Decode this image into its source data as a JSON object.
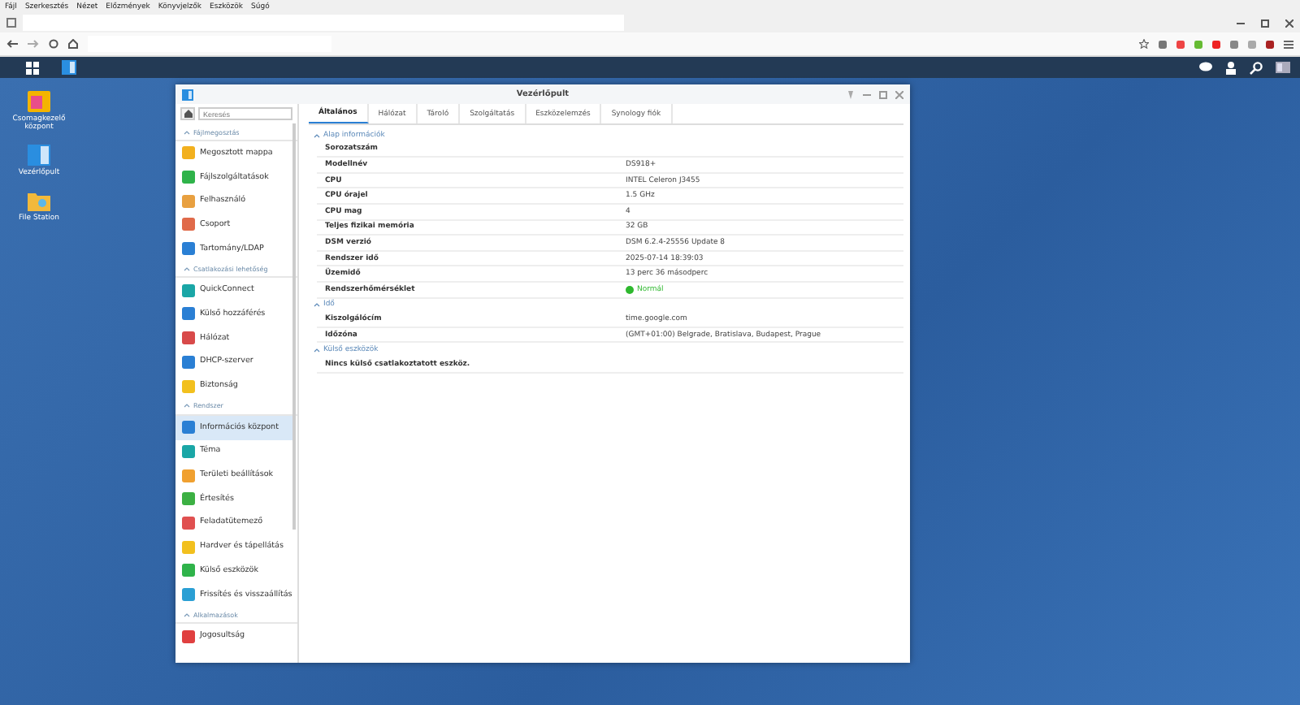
{
  "browser": {
    "menu": [
      "Fájl",
      "Szerkesztés",
      "Nézet",
      "Előzmények",
      "Könyvjelzők",
      "Eszközök",
      "Súgó"
    ]
  },
  "desktop_icons": [
    {
      "label": "Csomagkezelő központ"
    },
    {
      "label": "Vezérlőpult"
    },
    {
      "label": "File Station"
    }
  ],
  "window": {
    "title": "Vezérlőpult",
    "search": {
      "placeholder": "Keresés"
    },
    "sidebar": [
      {
        "section": "Fájlmegosztás",
        "items": [
          {
            "label": "Megosztott mappa",
            "selected": false
          },
          {
            "label": "Fájlszolgáltatások",
            "selected": false
          },
          {
            "label": "Felhasználó",
            "selected": false
          },
          {
            "label": "Csoport",
            "selected": false
          },
          {
            "label": "Tartomány/LDAP",
            "selected": false
          }
        ]
      },
      {
        "section": "Csatlakozási lehetőség",
        "items": [
          {
            "label": "QuickConnect",
            "selected": false
          },
          {
            "label": "Külső hozzáférés",
            "selected": false
          },
          {
            "label": "Hálózat",
            "selected": false
          },
          {
            "label": "DHCP-szerver",
            "selected": false
          },
          {
            "label": "Biztonság",
            "selected": false
          }
        ]
      },
      {
        "section": "Rendszer",
        "items": [
          {
            "label": "Információs központ",
            "selected": true
          },
          {
            "label": "Téma",
            "selected": false
          },
          {
            "label": "Területi beállítások",
            "selected": false
          },
          {
            "label": "Értesítés",
            "selected": false
          },
          {
            "label": "Feladatütemező",
            "selected": false
          },
          {
            "label": "Hardver és tápellátás",
            "selected": false
          },
          {
            "label": "Külső eszközök",
            "selected": false
          },
          {
            "label": "Frissítés és visszaállítás",
            "selected": false
          }
        ]
      },
      {
        "section": "Alkalmazások",
        "items": [
          {
            "label": "Jogosultság",
            "selected": false
          }
        ]
      }
    ],
    "tabs": [
      {
        "label": "Általános",
        "selected": true
      },
      {
        "label": "Hálózat",
        "selected": false
      },
      {
        "label": "Tároló",
        "selected": false
      },
      {
        "label": "Szolgáltatás",
        "selected": false
      },
      {
        "label": "Eszközelemzés",
        "selected": false
      },
      {
        "label": "Synology fiók",
        "selected": false
      }
    ],
    "sections": [
      {
        "title": "Alap információk",
        "rows": [
          {
            "label": "Sorozatszám",
            "value": ""
          },
          {
            "label": "Modellnév",
            "value": "DS918+"
          },
          {
            "label": "CPU",
            "value": "INTEL Celeron J3455"
          },
          {
            "label": "CPU órajel",
            "value": "1.5 GHz"
          },
          {
            "label": "CPU mag",
            "value": "4"
          },
          {
            "label": "Teljes fizikai memória",
            "value": "32 GB"
          },
          {
            "label": "DSM verzió",
            "value": "DSM 6.2.4-25556 Update 8"
          },
          {
            "label": "Rendszer idő",
            "value": "2025-07-14 18:39:03"
          },
          {
            "label": "Üzemidő",
            "value": "13 perc 36 másodperc"
          },
          {
            "label": "Rendszerhőmérséklet",
            "value": "Normál",
            "kind": "status",
            "color": "#2eb82e"
          }
        ]
      },
      {
        "title": "Idő",
        "rows": [
          {
            "label": "Kiszolgálócím",
            "value": "time.google.com"
          },
          {
            "label": "Időzóna",
            "value": "(GMT+01:00) Belgrade, Bratislava, Budapest, Prague"
          }
        ]
      },
      {
        "title": "Külső eszközök",
        "rows": [
          {
            "label": "Nincs külső csatlakoztatott eszköz.",
            "value": ""
          }
        ]
      }
    ]
  }
}
